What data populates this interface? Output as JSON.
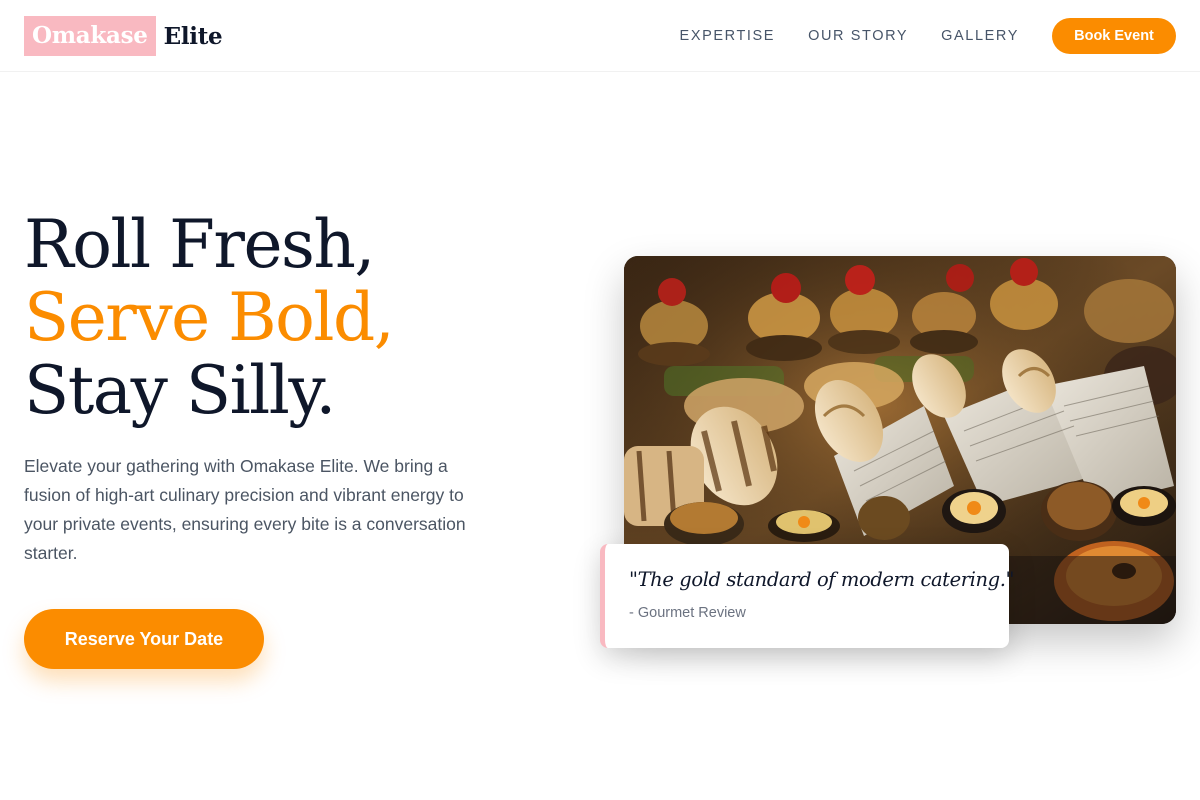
{
  "brand": {
    "name_highlight": "Omakase",
    "name_rest": "Elite",
    "highlight_color": "#f9b9c1"
  },
  "nav": {
    "links": [
      "EXPERTISE",
      "OUR STORY",
      "GALLERY"
    ],
    "cta_label": "Book Event"
  },
  "hero": {
    "title_line1": "Roll Fresh,",
    "title_line2": "Serve Bold,",
    "title_line3": "Stay Silly.",
    "accent_color": "#fb8c00",
    "description": "Elevate your gathering with Omakase Elite. We bring a fusion of high-art culinary precision and vibrant energy to your private events, ensuring every bite is a conversation starter.",
    "cta_label": "Reserve Your Date"
  },
  "image": {
    "alt": "Catering platter with sushi rolls, wraps in newspaper and mini sliders"
  },
  "testimonial": {
    "quote": "\"The gold standard of modern catering.\"",
    "source": "- Gourmet Review"
  }
}
